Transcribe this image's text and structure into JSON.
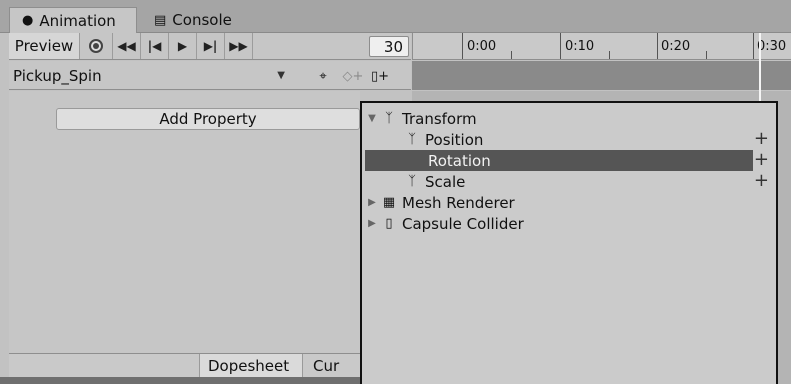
{
  "tabs": {
    "animation": "Animation",
    "console": "Console"
  },
  "toolbar": {
    "preview_label": "Preview",
    "frame_value": "30"
  },
  "timeline": {
    "labels": [
      "0:00",
      "0:10",
      "0:20",
      "0:30"
    ]
  },
  "clip": {
    "name": "Pickup_Spin"
  },
  "properties": {
    "add_property_label": "Add Property"
  },
  "popup": {
    "transform": "Transform",
    "position": "Position",
    "rotation": "Rotation",
    "scale": "Scale",
    "mesh_renderer": "Mesh Renderer",
    "capsule_collider": "Capsule Collider",
    "plus": "+"
  },
  "bottom_tabs": {
    "dopesheet": "Dopesheet",
    "curves": "Cur"
  },
  "colors": {
    "selection": "#555555",
    "panel": "#c6c6c6"
  }
}
